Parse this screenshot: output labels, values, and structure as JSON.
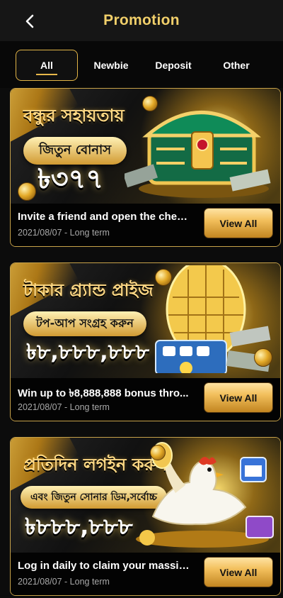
{
  "header": {
    "title": "Promotion",
    "back_icon": "chevron-left-icon"
  },
  "tabs": [
    {
      "label": "All",
      "active": true
    },
    {
      "label": "Newbie"
    },
    {
      "label": "Deposit"
    },
    {
      "label": "Other"
    }
  ],
  "promotions": [
    {
      "line1": "বন্ধুর সহায়তায়",
      "line2": "জিতুন বোনাস",
      "amount": "৳৩৭৭",
      "description": "Invite a friend and open the ches...",
      "date": "2021/08/07 - Long term",
      "button": "View All",
      "image_icon": "treasure-chest-icon"
    },
    {
      "line1": "টাকার গ্র্যান্ড প্রাইজ",
      "line2": "টপ-আপ সংগ্রহ করুন",
      "amount": "৳৮,৮৮৮,৮৮৮",
      "description": "Win up to ৳8,888,888 bonus thro...",
      "date": "2021/08/07 - Long term",
      "button": "View All",
      "image_icon": "golden-egg-icon"
    },
    {
      "line1": "প্রতিদিন লগইন করুন",
      "line2": "এবং জিতুন সোনার ডিম,সর্বোচ্চ",
      "amount": "৳৮৮৮,৮৮৮",
      "description": "Log in daily to claim your massiv...",
      "date": "2021/08/07 - Long term",
      "button": "View All",
      "image_icon": "golden-chicken-icon"
    }
  ],
  "colors": {
    "accent": "#e2b447",
    "title": "#f1cf6a",
    "background": "#0c0c0c"
  }
}
